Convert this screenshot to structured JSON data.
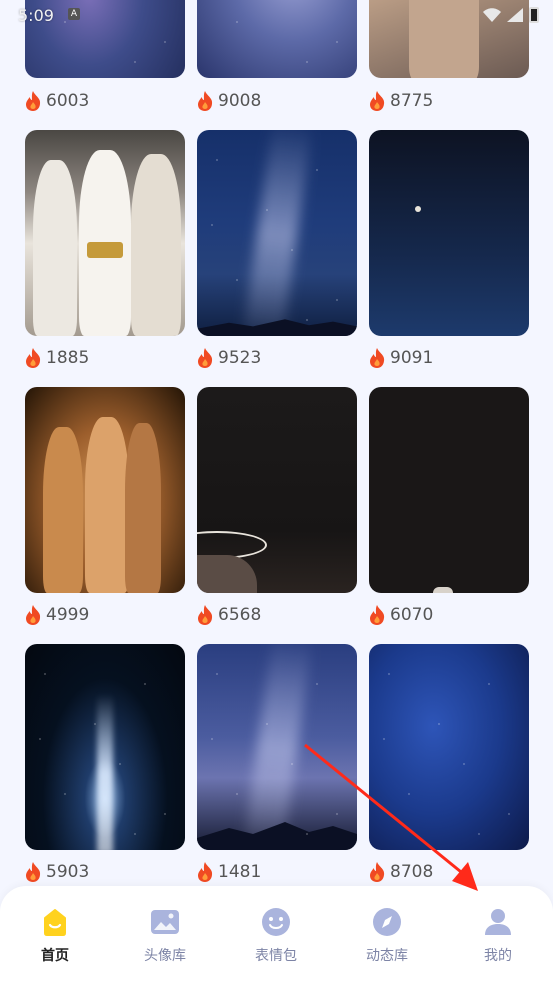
{
  "status_bar": {
    "time": "5:09",
    "badge": "A"
  },
  "grid": {
    "items": [
      {
        "count": "6003",
        "art": "galaxy-purple"
      },
      {
        "count": "9008",
        "art": "galaxy-soft"
      },
      {
        "count": "8775",
        "art": "fashion-gold"
      },
      {
        "count": "1885",
        "art": "fashion-white"
      },
      {
        "count": "9523",
        "art": "milky-blue"
      },
      {
        "count": "9091",
        "art": "moon-night"
      },
      {
        "count": "4999",
        "art": "fashion-orange"
      },
      {
        "count": "6568",
        "art": "dark-ring"
      },
      {
        "count": "6070",
        "art": "dark"
      },
      {
        "count": "5903",
        "art": "beam"
      },
      {
        "count": "1481",
        "art": "milky-mount"
      },
      {
        "count": "8708",
        "art": "blue-stars"
      }
    ]
  },
  "tabbar": {
    "tabs": [
      {
        "label": "首页",
        "icon": "home-icon",
        "active": true
      },
      {
        "label": "头像库",
        "icon": "image-icon",
        "active": false
      },
      {
        "label": "表情包",
        "icon": "smiley-icon",
        "active": false
      },
      {
        "label": "动态库",
        "icon": "compass-icon",
        "active": false
      },
      {
        "label": "我的",
        "icon": "user-icon",
        "active": false
      }
    ]
  },
  "colors": {
    "accent": "#ffd21e",
    "tab_inactive": "#aab4dd",
    "flame": "#f04a23",
    "arrow": "#ff2a1a"
  }
}
